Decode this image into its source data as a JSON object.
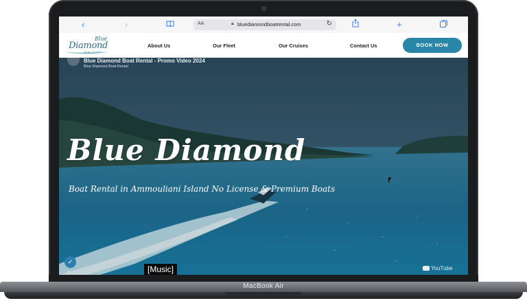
{
  "device": {
    "label": "MacBook Air"
  },
  "browser": {
    "text_size": "AA",
    "url": "bluediamondboatrental.com",
    "icons": [
      "back-icon",
      "forward-icon",
      "reader-icon",
      "lock-icon",
      "reload-icon",
      "share-icon",
      "new-tab-icon",
      "tabs-icon"
    ]
  },
  "site": {
    "logo": {
      "line1": "Blue",
      "line2": "Diamond",
      "line3": "boat rental"
    },
    "nav": [
      "About Us",
      "Our Fleet",
      "Our Cruises",
      "Contact Us"
    ],
    "book_button": "BOOK NOW",
    "accent_color": "#2a86a8"
  },
  "video": {
    "title": "Blue Diamond Boat Rental - Promo Video 2024",
    "channel": "Blue Diamond Boat Rental",
    "hero_title": "Blue Diamond",
    "hero_subtitle": "Boat Rental in Ammouliani Island No License & Premium Boats",
    "caption": "[Music]",
    "platform": "YouTube"
  }
}
